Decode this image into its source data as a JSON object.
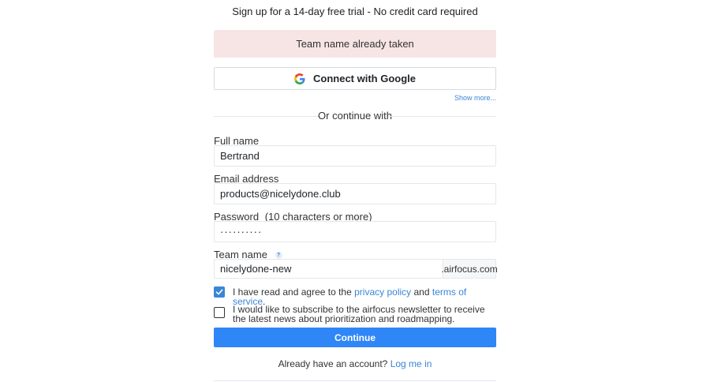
{
  "header": {
    "subtitle": "Sign up for a 14-day free trial - No credit card required"
  },
  "alert": {
    "message": "Team name already taken"
  },
  "google": {
    "label": "Connect with Google",
    "icon": "google-g-icon"
  },
  "show_more": "Show more...",
  "divider": {
    "text": "Or continue with"
  },
  "fields": {
    "full_name": {
      "label": "Full name",
      "value": "Bertrand"
    },
    "email": {
      "label": "Email address",
      "value": "products@nicelydone.club"
    },
    "password": {
      "label": "Password",
      "hint": "(10 characters or more)",
      "value": "··········"
    },
    "team_name": {
      "label": "Team name",
      "help": "?",
      "value": "nicelydone-new",
      "suffix": ".airfocus.com"
    }
  },
  "consents": {
    "terms": {
      "checked": true,
      "prefix": "I have read and agree to the ",
      "privacy_link": "privacy policy",
      "middle": " and ",
      "terms_link": "terms of service",
      "suffix": "."
    },
    "newsletter": {
      "checked": false,
      "text": "I would like to subscribe to the airfocus newsletter to receive the latest news about prioritization and roadmapping."
    }
  },
  "cta": {
    "continue_label": "Continue"
  },
  "login": {
    "prompt": "Already have an account?",
    "link": "Log me in"
  },
  "colors": {
    "primary": "#2f86f6",
    "link": "#3a86d6",
    "error_bg": "#f7e4e4"
  }
}
